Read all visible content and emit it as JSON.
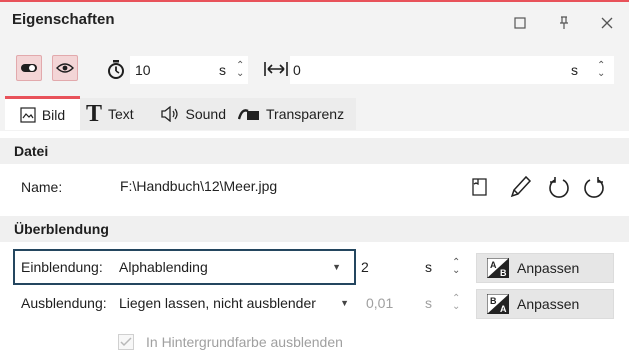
{
  "window": {
    "title": "Eigenschaften"
  },
  "toolbar": {
    "duration_value": "10",
    "duration_unit": "s",
    "width_value": "0",
    "width_unit": "s"
  },
  "tabs": [
    {
      "label": "Bild"
    },
    {
      "label": "Text"
    },
    {
      "label": "Sound"
    },
    {
      "label": "Transparenz"
    }
  ],
  "datei": {
    "section_title": "Datei",
    "name_label": "Name:",
    "name_value": "F:\\Handbuch\\12\\Meer.jpg"
  },
  "ueberblendung": {
    "section_title": "Überblendung",
    "einblendung_label": "Einblendung:",
    "einblendung_value": "Alphablending",
    "einblendung_time": "2",
    "einblendung_unit": "s",
    "einblendung_button": "Anpassen",
    "ausblendung_label": "Ausblendung:",
    "ausblendung_value": "Liegen lassen, nicht ausblender",
    "ausblendung_time": "0,01",
    "ausblendung_unit": "s",
    "ausblendung_button": "Anpassen",
    "checkbox_label": "In Hintergrundfarbe ausblenden",
    "checkbox_checked": true
  },
  "colors": {
    "accent": "#e8525a",
    "focus_border": "#24465f",
    "toggle_bg": "#f3d5d6"
  }
}
